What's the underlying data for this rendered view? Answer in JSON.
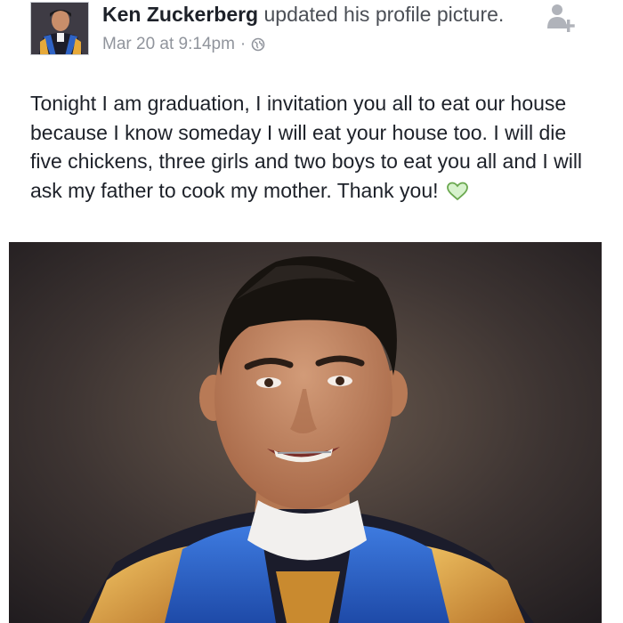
{
  "post": {
    "author": "Ken Zuckerberg",
    "action": "updated his profile picture.",
    "timestamp": "Mar 20 at 9:14pm",
    "separator": "·",
    "privacy_icon": "globe-icon",
    "add_friend_icon": "add-friend-icon",
    "text": "Tonight I am graduation, I invitation you all to eat our house because I know someday I will eat your house too. I will die five chickens, three girls and two boys to eat you all and I will ask my father to cook my mother. Thank you!",
    "emoji_icon": "green-heart-icon"
  },
  "colors": {
    "text": "#1d2129",
    "secondary": "#90949c",
    "heart_fill": "#d7f2cd",
    "heart_stroke": "#6aa84f"
  }
}
